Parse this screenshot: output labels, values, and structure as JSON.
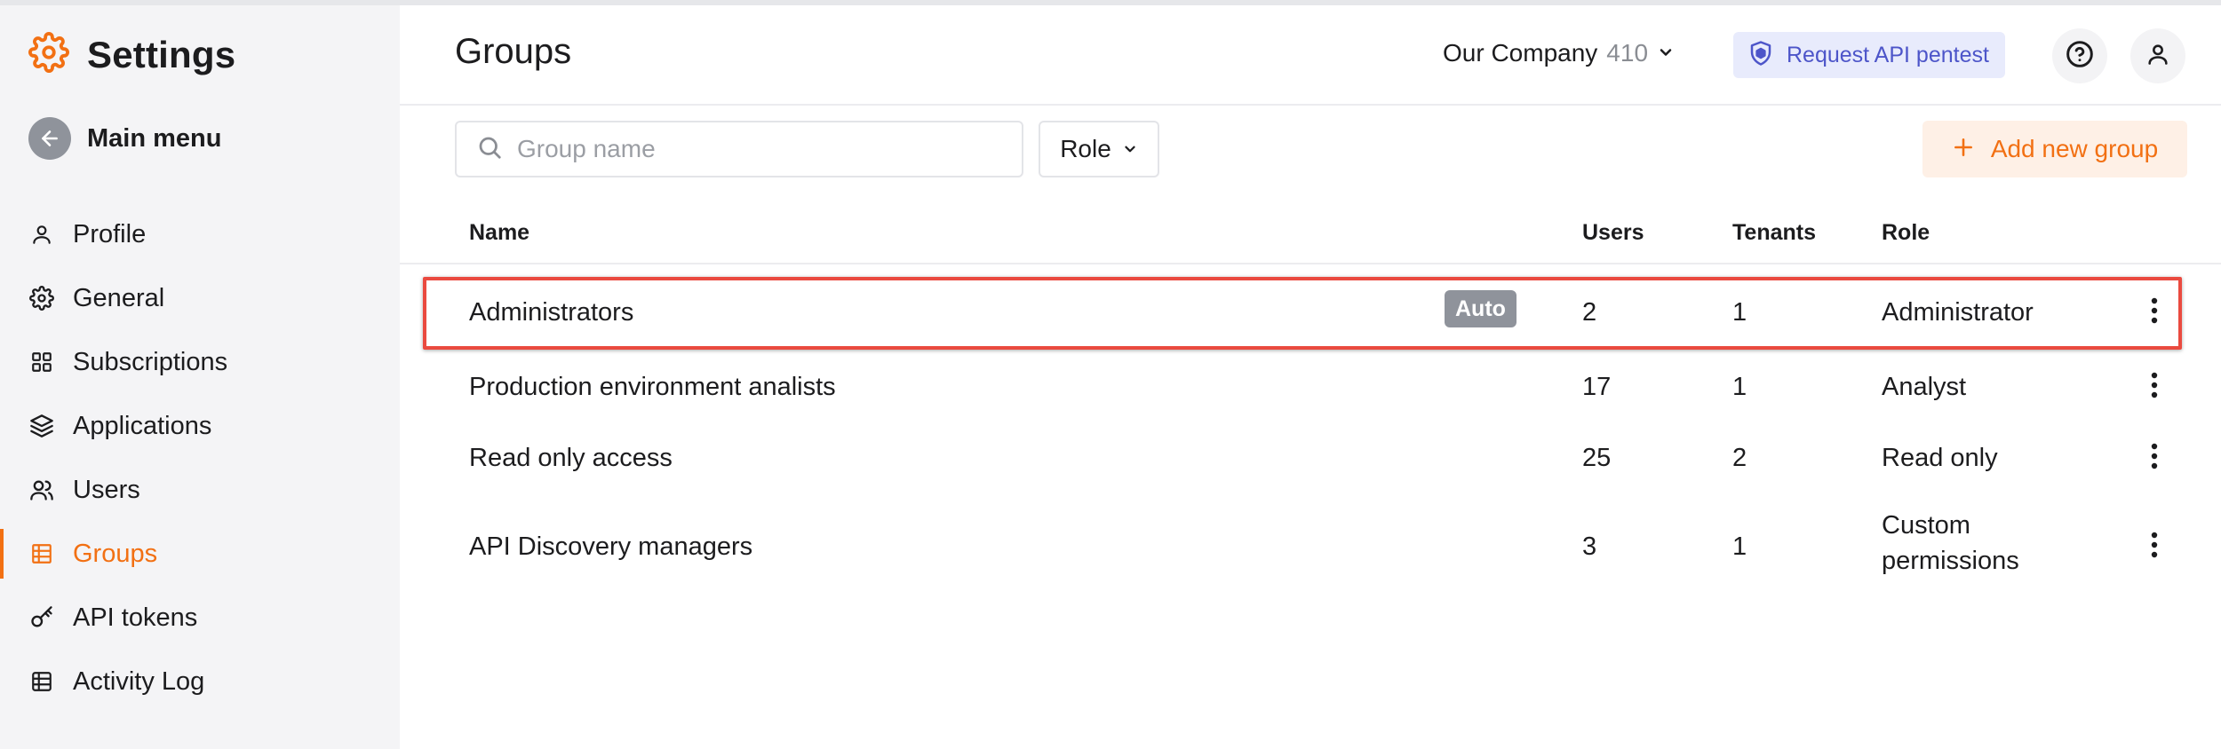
{
  "sidebar": {
    "title": "Settings",
    "back_label": "Main menu",
    "items": [
      {
        "label": "Profile",
        "icon": "person-icon"
      },
      {
        "label": "General",
        "icon": "gear-icon"
      },
      {
        "label": "Subscriptions",
        "icon": "grid-icon"
      },
      {
        "label": "Applications",
        "icon": "layers-icon"
      },
      {
        "label": "Users",
        "icon": "users-icon"
      },
      {
        "label": "Groups",
        "icon": "groups-icon",
        "active": true
      },
      {
        "label": "API tokens",
        "icon": "key-icon"
      },
      {
        "label": "Activity Log",
        "icon": "log-icon"
      }
    ]
  },
  "header": {
    "title": "Groups",
    "company_name": "Our Company",
    "company_count": "410",
    "pentest_label": "Request API pentest"
  },
  "toolbar": {
    "search_placeholder": "Group name",
    "role_filter_label": "Role",
    "add_button_label": "Add new group"
  },
  "table": {
    "columns": [
      "Name",
      "Users",
      "Tenants",
      "Role"
    ],
    "rows": [
      {
        "name": "Administrators",
        "badge": "Auto",
        "users": "2",
        "tenants": "1",
        "role": "Administrator",
        "highlighted": true
      },
      {
        "name": "Production environment analists",
        "users": "17",
        "tenants": "1",
        "role": "Analyst"
      },
      {
        "name": "Read only access",
        "users": "25",
        "tenants": "2",
        "role": "Read only"
      },
      {
        "name": "API Discovery managers",
        "users": "3",
        "tenants": "1",
        "role_line1": "Custom",
        "role_line2": "permissions"
      }
    ]
  },
  "colors": {
    "accent": "#f27013",
    "pentest_text": "#4d55c9",
    "highlight_border": "#ea4a3f",
    "sidebar_bg": "#f4f4f6"
  }
}
